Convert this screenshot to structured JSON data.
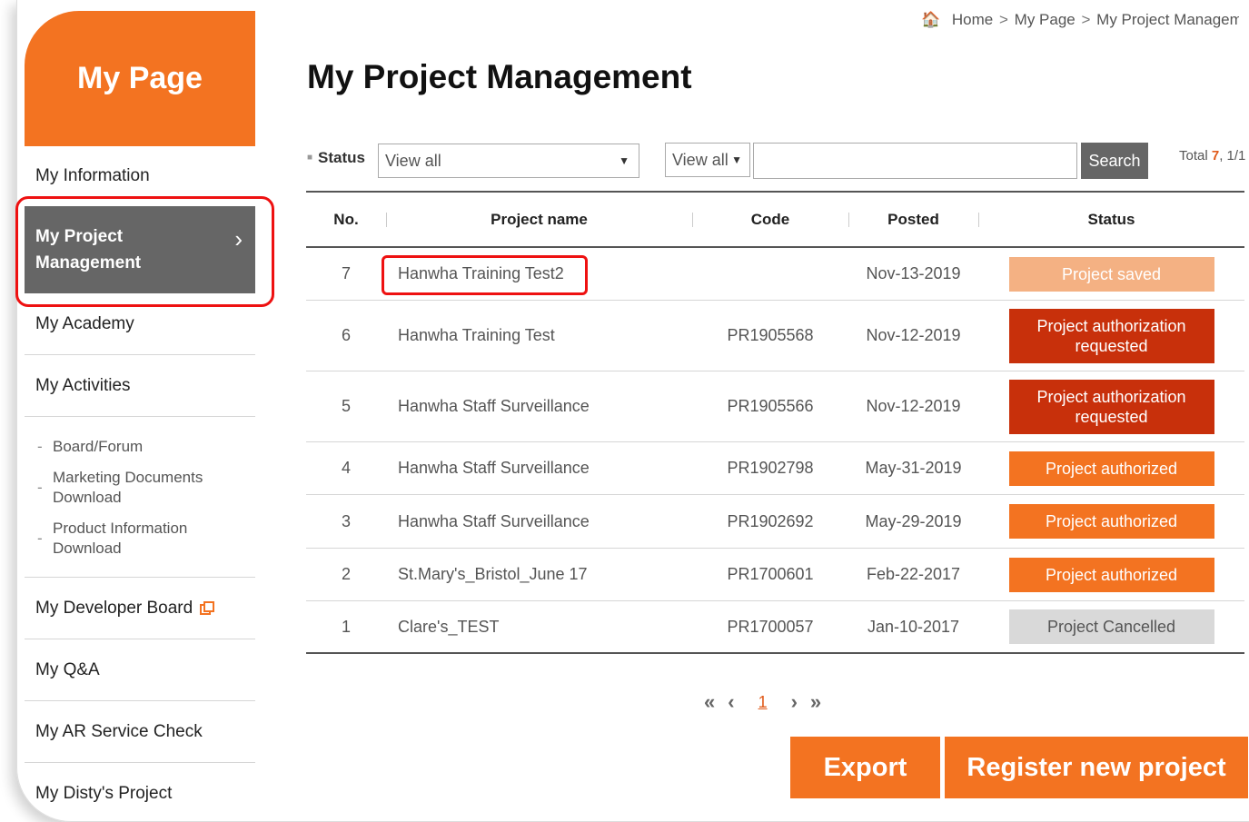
{
  "sidebar": {
    "title": "My Page",
    "items": {
      "my_information": "My Information",
      "my_project_management_line1": "My Project",
      "my_project_management_line2": "Management",
      "my_academy": "My Academy",
      "my_activities": "My Activities",
      "my_developer_board": "My Developer Board",
      "my_qa": "My Q&A",
      "my_ar_service_check": "My AR Service Check",
      "my_distys_project": "My Disty's Project"
    },
    "sub_items": [
      "Board/Forum",
      "Marketing Documents Download",
      "Product Information Download"
    ],
    "dash": "-",
    "chevron": "›"
  },
  "breadcrumb": {
    "home_icon": "🏠",
    "home": "Home",
    "sep": ">",
    "my_page": "My Page",
    "current": "My Project Management"
  },
  "page_title": "My Project Management",
  "filters": {
    "status_label": "Status",
    "status_select": "View all",
    "type_select": "View all",
    "search_value": "",
    "search_button": "Search",
    "total_label": "Total",
    "total_count": "7",
    "total_pages": ", 1/1"
  },
  "table": {
    "headers": {
      "no": "No.",
      "name": "Project name",
      "code": "Code",
      "posted": "Posted",
      "status": "Status"
    },
    "rows": [
      {
        "no": "7",
        "name": "Hanwha Training Test2",
        "code": "",
        "posted": "Nov-13-2019",
        "status": "Project saved"
      },
      {
        "no": "6",
        "name": "Hanwha Training Test",
        "code": "PR1905568",
        "posted": "Nov-12-2019",
        "status": "Project authorization requested"
      },
      {
        "no": "5",
        "name": "Hanwha Staff Surveillance",
        "code": "PR1905566",
        "posted": "Nov-12-2019",
        "status": "Project authorization requested"
      },
      {
        "no": "4",
        "name": "Hanwha Staff Surveillance",
        "code": "PR1902798",
        "posted": "May-31-2019",
        "status": "Project authorized"
      },
      {
        "no": "3",
        "name": "Hanwha Staff Surveillance",
        "code": "PR1902692",
        "posted": "May-29-2019",
        "status": "Project authorized"
      },
      {
        "no": "2",
        "name": "St.Mary's_Bristol_June 17",
        "code": "PR1700601",
        "posted": "Feb-22-2017",
        "status": "Project authorized"
      },
      {
        "no": "1",
        "name": "Clare's_TEST",
        "code": "PR1700057",
        "posted": "Jan-10-2017",
        "status": "Project Cancelled"
      }
    ]
  },
  "status_colors": {
    "Project saved": "#f4b183",
    "Project authorization requested": "#c8300b",
    "Project authorized": "#f37321",
    "Project Cancelled": "#d9d9d9"
  },
  "pagination": {
    "first": "«",
    "prev": "‹",
    "current": "1",
    "next": "›",
    "last": "»"
  },
  "buttons": {
    "export": "Export",
    "register": "Register new project"
  }
}
